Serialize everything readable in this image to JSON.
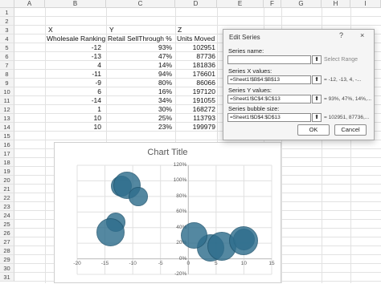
{
  "columns": [
    "A",
    "B",
    "C",
    "D",
    "E",
    "F",
    "G",
    "H",
    "I"
  ],
  "rows": [
    "1",
    "2",
    "3",
    "4",
    "5",
    "6",
    "7",
    "8",
    "9",
    "10",
    "11",
    "12",
    "13",
    "14",
    "15",
    "16",
    "17",
    "18",
    "19",
    "20",
    "21",
    "22",
    "23",
    "24",
    "25",
    "26",
    "27",
    "28",
    "29",
    "30",
    "31"
  ],
  "table": {
    "row2": {
      "b": "X",
      "c": "Y",
      "d": "Z"
    },
    "headers": {
      "b": "Wholesale Ranking",
      "c": "Retail SellThrough %",
      "d": "Units Moved"
    },
    "data": [
      {
        "x": "-12",
        "y": "93%",
        "z": "102951"
      },
      {
        "x": "-13",
        "y": "47%",
        "z": "87736"
      },
      {
        "x": "4",
        "y": "14%",
        "z": "181836"
      },
      {
        "x": "-11",
        "y": "94%",
        "z": "176601"
      },
      {
        "x": "-9",
        "y": "80%",
        "z": "86066"
      },
      {
        "x": "6",
        "y": "16%",
        "z": "197120"
      },
      {
        "x": "-14",
        "y": "34%",
        "z": "191055"
      },
      {
        "x": "1",
        "y": "30%",
        "z": "168272"
      },
      {
        "x": "10",
        "y": "25%",
        "z": "113793"
      },
      {
        "x": "10",
        "y": "23%",
        "z": "199979"
      }
    ]
  },
  "chart_data": {
    "type": "scatter",
    "title": "Chart Title",
    "x": [
      -12,
      -13,
      4,
      -11,
      -9,
      6,
      -14,
      1,
      10,
      10
    ],
    "y": [
      0.93,
      0.47,
      0.14,
      0.94,
      0.8,
      0.16,
      0.34,
      0.3,
      0.25,
      0.23
    ],
    "size": [
      102951,
      87736,
      181836,
      176601,
      86066,
      197120,
      191055,
      168272,
      113793,
      199979
    ],
    "xlim": [
      -20,
      15
    ],
    "ylim": [
      -0.2,
      1.2
    ],
    "xticks": [
      "-20",
      "-15",
      "-10",
      "-5",
      "0",
      "5",
      "10",
      "15"
    ],
    "yticks": [
      "120%",
      "100%",
      "80%",
      "60%",
      "40%",
      "20%",
      "0%",
      "-20%"
    ],
    "grid": true,
    "color": "#2f6e8d"
  },
  "dialog": {
    "title": "Edit Series",
    "help": "?",
    "close": "×",
    "series_name_label": "Series name:",
    "series_name_value": "",
    "select_range": "Select Range",
    "x_label": "Series X values:",
    "x_value": "=Sheet1!$B$4:$B$13",
    "x_preview": "= -12, -13, 4, -...",
    "y_label": "Series Y values:",
    "y_value": "=Sheet1!$C$4:$C$13",
    "y_preview": "= 93%, 47%, 14%,...",
    "bubble_label": "Series bubble size:",
    "bubble_value": "=Sheet1!$D$4:$D$13",
    "bubble_preview": "= 102951, 87736,...",
    "ok": "OK",
    "cancel": "Cancel",
    "collapse_glyph": "⬆"
  }
}
